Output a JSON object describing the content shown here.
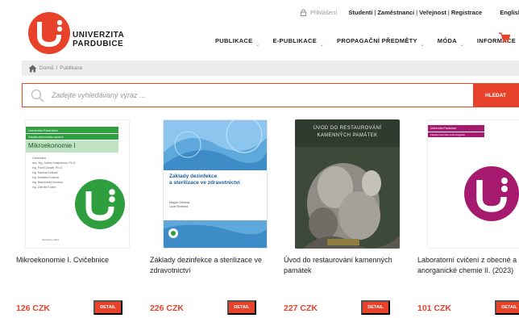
{
  "header": {
    "logo_text": [
      "UNIVERZITA",
      "PARDUBICE"
    ],
    "top_links": {
      "login": "Přihlášení",
      "items": [
        "Studenti",
        "Zaměstnanci",
        "Veřejnost",
        "Registrace"
      ],
      "separator": "|",
      "language": "English"
    },
    "nav": [
      "PUBLIKACE",
      "E-PUBLIKACE",
      "PROPAGAČNÍ PŘEDMĚTY",
      "MÓDA",
      "INFORMACE"
    ]
  },
  "breadcrumb": [
    "Domů",
    "Publikace"
  ],
  "breadcrumb_separator": "/",
  "search": {
    "placeholder": "Zadejte vyhledávaný výraz ...",
    "button_label": "HLEDAT"
  },
  "products": [
    {
      "title": "Mikroekonomie I. Cvičebnice",
      "price": "126 CZK",
      "detail_label": "DETAIL",
      "cover": {
        "band1": "Univerzita Pardubice",
        "band2": "Fakulta ekonomicko-správní",
        "title": "Mikroekonomie I",
        "subtitle": "Cvičebnice",
        "authors": [
          "doc. Ing. Jolana Volejníková, Ph.D.",
          "Ing. Pavel Zdražil, Ph.D.",
          "Ing. Martina Kubová",
          "Ing. Markéta Kozlová",
          "Ing. Bartoloměj Hinnerer",
          "Ing. Zdeněk Kubec"
        ],
        "footer": "Pardubice 2023"
      }
    },
    {
      "title": "Základy dezinfekce a sterilizace ve zdravotnictví",
      "price": "226 CZK",
      "detail_label": "DETAIL",
      "cover": {
        "title": [
          "Základy dezinfekce",
          "a sterilizace ve zdravotnictví"
        ],
        "authors": [
          "Magda Ciahlová",
          "Lucie Brostová"
        ]
      }
    },
    {
      "title": "Úvod do restaurování kamenných památek",
      "price": "227 CZK",
      "detail_label": "DETAIL",
      "cover": {
        "title": [
          "ÚVOD DO RESTAUROVÁNÍ",
          "KAMENNÝCH PAMÁTEK"
        ]
      }
    },
    {
      "title": "Laboratorní cvičení z obecné a anorganické chemie II. (2023)",
      "price": "101 CZK",
      "detail_label": "DETAIL",
      "cover": {
        "band1": "Univerzita Pardubice",
        "band2": "Fakulta chemicko-technologická"
      }
    }
  ],
  "colors": {
    "accent": "#e8432a",
    "green": "#2e9e3f",
    "magenta": "#a51a6e",
    "logo_red": "#e8432a"
  },
  "icons": [
    "lock-icon",
    "cart-icon",
    "home-icon",
    "search-icon",
    "chevron-down-icon"
  ]
}
